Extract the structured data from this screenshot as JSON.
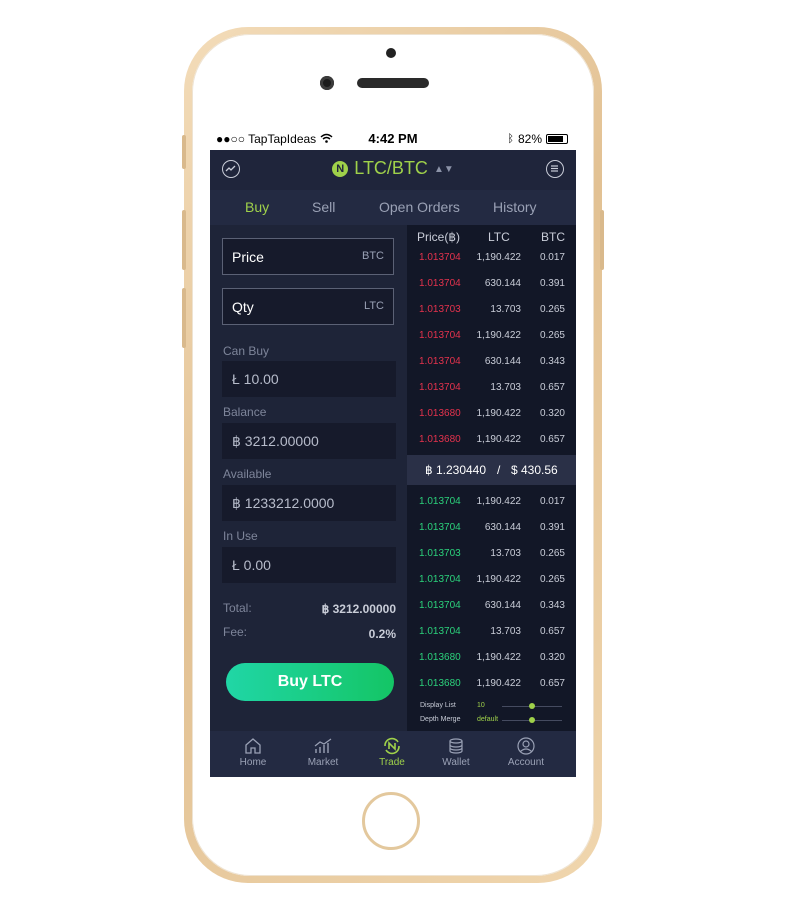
{
  "status_bar": {
    "carrier": "●●○○ TapTapIdeas",
    "time": "4:42 PM",
    "battery": "82%"
  },
  "header": {
    "pair": "LTC/BTC",
    "logo": "N"
  },
  "tabs": [
    {
      "label": "Buy"
    },
    {
      "label": "Sell"
    },
    {
      "label": "Open Orders"
    },
    {
      "label": "History"
    }
  ],
  "form": {
    "price": {
      "label": "Price",
      "unit": "BTC"
    },
    "qty": {
      "label": "Qty",
      "unit": "LTC"
    },
    "can_buy": {
      "label": "Can Buy",
      "value": "Ł  10.00"
    },
    "balance": {
      "label": "Balance",
      "value": "฿  3212.00000"
    },
    "available": {
      "label": "Available",
      "value": "฿  1233212.0000"
    },
    "in_use": {
      "label": "In Use",
      "value": "Ł  0.00"
    },
    "total": {
      "label": "Total:",
      "value": "฿ 3212.00000"
    },
    "fee": {
      "label": "Fee:",
      "value": "0.2%"
    },
    "button": "Buy LTC"
  },
  "order_book": {
    "headers": {
      "price": "Price(฿)",
      "qty": "LTC",
      "total": "BTC"
    },
    "sells": [
      {
        "price": "1.013704",
        "qty": "1,190.422",
        "total": "0.017"
      },
      {
        "price": "1.013704",
        "qty": "630.144",
        "total": "0.391"
      },
      {
        "price": "1.013703",
        "qty": "13.703",
        "total": "0.265"
      },
      {
        "price": "1.013704",
        "qty": "1,190.422",
        "total": "0.265"
      },
      {
        "price": "1.013704",
        "qty": "630.144",
        "total": "0.343"
      },
      {
        "price": "1.013704",
        "qty": "13.703",
        "total": "0.657"
      },
      {
        "price": "1.013680",
        "qty": "1,190.422",
        "total": "0.320"
      },
      {
        "price": "1.013680",
        "qty": "1,190.422",
        "total": "0.657"
      }
    ],
    "mid": {
      "btc": "฿ 1.230440",
      "sep": "/",
      "usd": "$ 430.56"
    },
    "buys": [
      {
        "price": "1.013704",
        "qty": "1,190.422",
        "total": "0.017"
      },
      {
        "price": "1.013704",
        "qty": "630.144",
        "total": "0.391"
      },
      {
        "price": "1.013703",
        "qty": "13.703",
        "total": "0.265"
      },
      {
        "price": "1.013704",
        "qty": "1,190.422",
        "total": "0.265"
      },
      {
        "price": "1.013704",
        "qty": "630.144",
        "total": "0.343"
      },
      {
        "price": "1.013704",
        "qty": "13.703",
        "total": "0.657"
      },
      {
        "price": "1.013680",
        "qty": "1,190.422",
        "total": "0.320"
      },
      {
        "price": "1.013680",
        "qty": "1,190.422",
        "total": "0.657"
      }
    ],
    "display_list": {
      "label": "Display List",
      "value": "10"
    },
    "depth_merge": {
      "label": "Depth Merge",
      "value": "default"
    }
  },
  "tab_bar": [
    {
      "label": "Home",
      "icon": "home-icon"
    },
    {
      "label": "Market",
      "icon": "market-icon"
    },
    {
      "label": "Trade",
      "icon": "trade-icon"
    },
    {
      "label": "Wallet",
      "icon": "wallet-icon"
    },
    {
      "label": "Account",
      "icon": "account-icon"
    }
  ],
  "colors": {
    "accent": "#9fd14a",
    "sell": "#e4324d",
    "buy": "#2bd17b",
    "background": "#1b2035"
  }
}
